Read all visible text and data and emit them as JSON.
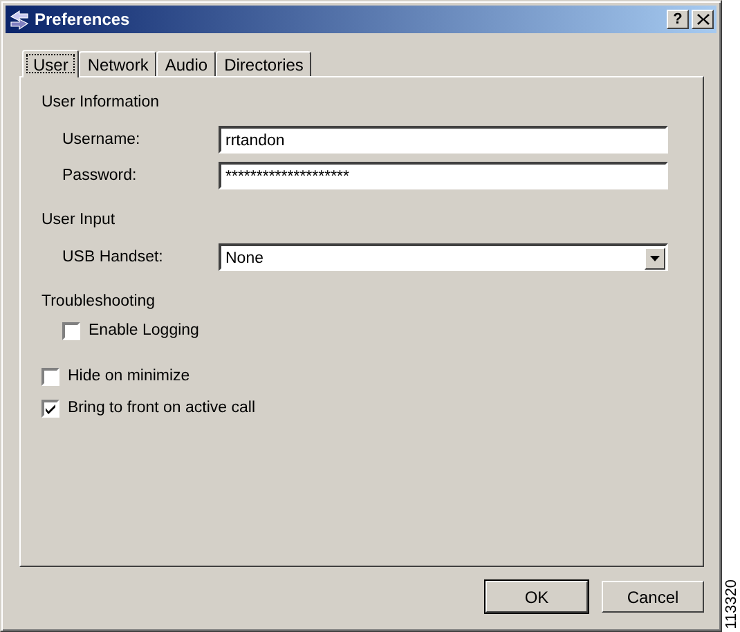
{
  "window": {
    "title": "Preferences",
    "help_button": "?"
  },
  "tabs": [
    {
      "label": "User",
      "selected": true
    },
    {
      "label": "Network",
      "selected": false
    },
    {
      "label": "Audio",
      "selected": false
    },
    {
      "label": "Directories",
      "selected": false
    }
  ],
  "sections": [
    {
      "title": "User Information",
      "items": [
        {
          "kind": "text",
          "label": "Username:",
          "value": "rrtandon"
        },
        {
          "kind": "text",
          "label": "Password:",
          "value": "********************"
        }
      ]
    },
    {
      "title": "User Input",
      "items": [
        {
          "kind": "select",
          "label": "USB Handset:",
          "value": "None"
        }
      ]
    },
    {
      "title": "Troubleshooting",
      "items": [
        {
          "kind": "checkbox",
          "label": "Enable Logging",
          "checked": false
        }
      ]
    }
  ],
  "options": [
    {
      "label": "Hide on minimize",
      "checked": false
    },
    {
      "label": "Bring to front on active call",
      "checked": true
    }
  ],
  "buttons": [
    {
      "label": "OK",
      "default": true
    },
    {
      "label": "Cancel",
      "default": false
    }
  ],
  "figure_id": "113320"
}
